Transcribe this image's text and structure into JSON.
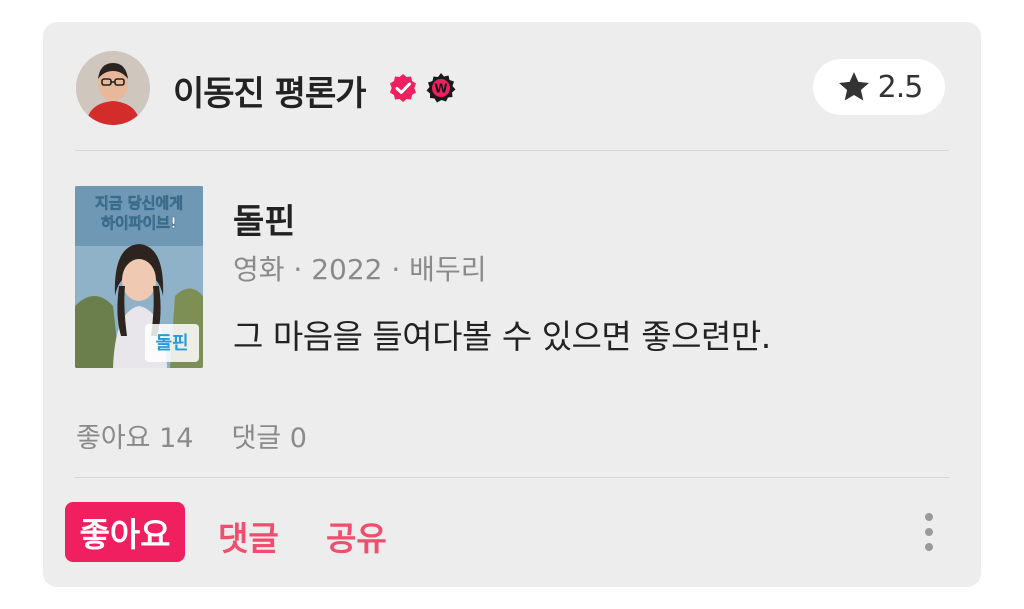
{
  "review": {
    "author": {
      "name": "이동진 평론가"
    },
    "rating": "2.5",
    "content": {
      "title": "돌핀",
      "meta": "영화 · 2022 · 배두리",
      "poster_title": "돌핀",
      "poster_tagline": "지금 당신에게 하이파이브!"
    },
    "text": "그 마음을 들여다볼 수 있으면 좋으련만.",
    "stats": {
      "likes": "좋아요 14",
      "comments": "댓글 0"
    }
  },
  "actions": {
    "like": "좋아요",
    "comment": "댓글",
    "share": "공유"
  },
  "colors": {
    "accent": "#f01f60",
    "action_text": "#f04e6c",
    "card_bg": "#ededed"
  },
  "icons": [
    "verified-badge-icon",
    "watcha-w-badge-icon",
    "star-icon",
    "more-vertical-icon"
  ]
}
